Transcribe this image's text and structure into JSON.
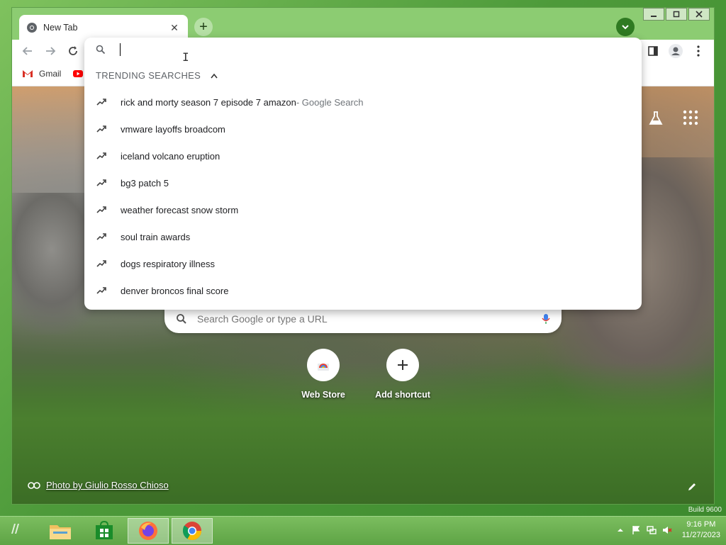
{
  "browser": {
    "tab_title": "New Tab",
    "tab_close": "✕",
    "new_tab": "+"
  },
  "bookmarks": {
    "items": [
      {
        "label": "Gmail"
      }
    ]
  },
  "omnibox": {
    "value": "",
    "trending_label": "TRENDING SEARCHES",
    "suggestions": [
      {
        "text": "rick and morty season 7 episode 7 amazon",
        "extra": " - Google Search"
      },
      {
        "text": "vmware layoffs broadcom",
        "extra": ""
      },
      {
        "text": "iceland volcano eruption",
        "extra": ""
      },
      {
        "text": "bg3 patch 5",
        "extra": ""
      },
      {
        "text": "weather forecast snow storm",
        "extra": ""
      },
      {
        "text": "soul train awards",
        "extra": ""
      },
      {
        "text": "dogs respiratory illness",
        "extra": ""
      },
      {
        "text": "denver broncos final score",
        "extra": ""
      }
    ]
  },
  "ntp": {
    "search_placeholder": "Search Google or type a URL",
    "shortcuts": [
      {
        "label": "Web Store"
      },
      {
        "label": "Add shortcut"
      }
    ],
    "photo_credit": "Photo by Giulio Rosso Chioso"
  },
  "desktop": {
    "watermark": "Build 9600"
  },
  "taskbar": {
    "time": "9:16 PM",
    "date": "11/27/2023"
  },
  "colors": {
    "frame_green": "#8ccc72",
    "accent_green": "#2f7a22",
    "taskbar_green": "#5ea445"
  }
}
